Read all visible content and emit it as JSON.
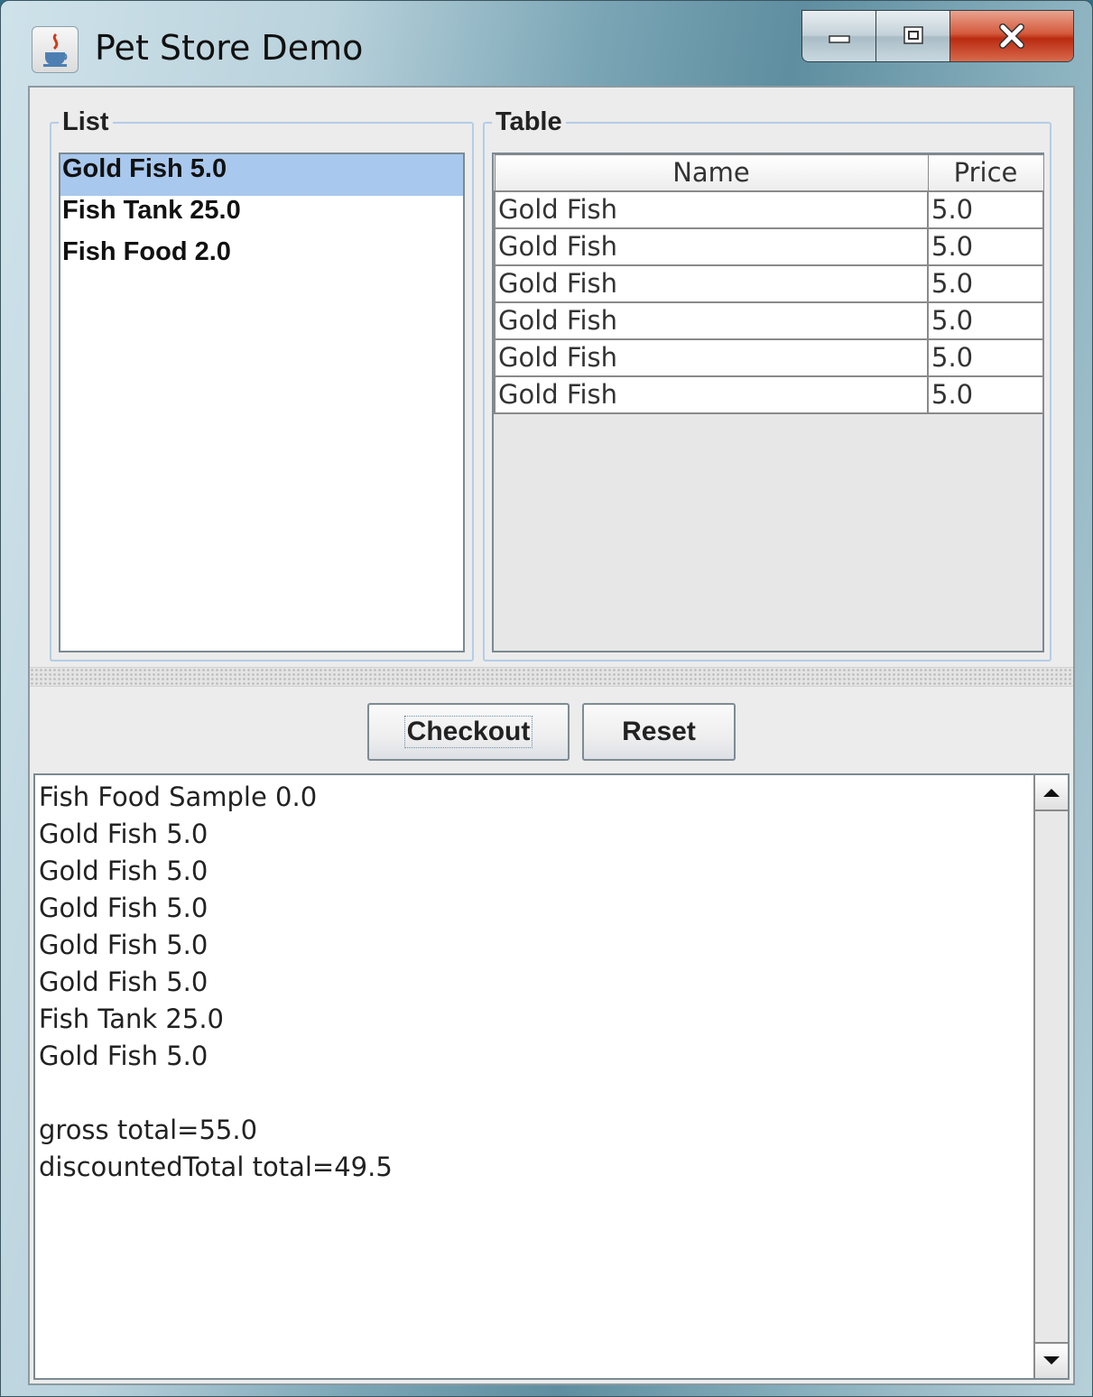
{
  "window": {
    "title": "Pet Store Demo"
  },
  "list_panel": {
    "label": "List",
    "items": [
      "Gold Fish 5.0",
      "Fish Tank 25.0",
      "Fish Food 2.0"
    ],
    "selected_index": 0
  },
  "table_panel": {
    "label": "Table",
    "columns": [
      "Name",
      "Price"
    ],
    "rows": [
      [
        "Gold Fish",
        "5.0"
      ],
      [
        "Gold Fish",
        "5.0"
      ],
      [
        "Gold Fish",
        "5.0"
      ],
      [
        "Gold Fish",
        "5.0"
      ],
      [
        "Gold Fish",
        "5.0"
      ],
      [
        "Gold Fish",
        "5.0"
      ]
    ]
  },
  "buttons": {
    "checkout": "Checkout",
    "reset": "Reset"
  },
  "output": {
    "lines": [
      "Fish Food Sample 0.0",
      "Gold Fish 5.0",
      "Gold Fish 5.0",
      "Gold Fish 5.0",
      "Gold Fish 5.0",
      "Gold Fish 5.0",
      "Fish Tank 25.0",
      "Gold Fish 5.0",
      "",
      "gross total=55.0",
      "discountedTotal total=49.5"
    ]
  },
  "colors": {
    "selection": "#a8c8ee",
    "group_border": "#b3cde6",
    "close_button": "#c43a1c"
  },
  "icons": [
    "java-cup-icon",
    "minimize-icon",
    "maximize-icon",
    "close-icon",
    "scroll-up-icon",
    "scroll-down-icon"
  ]
}
